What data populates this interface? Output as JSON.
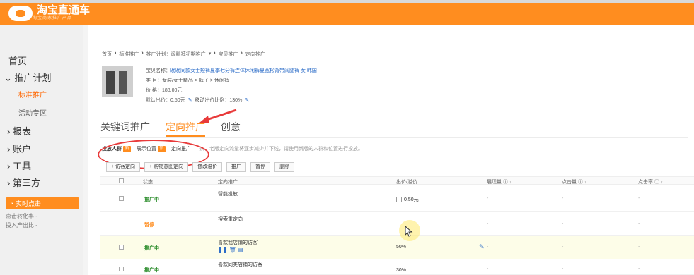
{
  "app": {
    "logo_text": "淘宝直通车",
    "logo_sub": "淘宝商家推广产品"
  },
  "sidebar": {
    "items": [
      {
        "label": "首页"
      },
      {
        "label": "推广计划",
        "prefix": "⌄"
      },
      {
        "label": "标准推广",
        "active": true
      },
      {
        "label": "活动专区"
      },
      {
        "label": "报表",
        "prefix": "›"
      },
      {
        "label": "账户",
        "prefix": "›"
      },
      {
        "label": "工具",
        "prefix": "›"
      },
      {
        "label": "第三方",
        "prefix": "›"
      }
    ],
    "realtime": {
      "button": "实时点击",
      "line1": "点击转化率  -",
      "line2": "投入产出比  -"
    }
  },
  "breadcrumb": [
    "首页",
    "标准推广",
    "推广计划：阔腿裤初期推广",
    "宝贝推广",
    "定向推广"
  ],
  "product": {
    "name_label": "宝贝名称：",
    "name": "晚晚同款女士短裤夏季七分裤连体休闲裤夏宽松背带阔腿裤 女 韩国",
    "category_label": "类    目：",
    "category": "女装/女士精品 > 裤子 > 休闲裤",
    "price_label": "价    格：",
    "price": "188.00元",
    "bid_label": "默认出价：",
    "bid": "0.50元",
    "mobile_label": "移动出价比例：",
    "mobile": "130%"
  },
  "tabs": [
    {
      "label": "关键词推广",
      "active": false
    },
    {
      "label": "定向推广",
      "active": true
    },
    {
      "label": "创意",
      "active": false
    }
  ],
  "subtabs": [
    {
      "label": "投放人群",
      "badge": "新"
    },
    {
      "label": "展示位置",
      "badge": "新"
    },
    {
      "label": "定向推广"
    }
  ],
  "notice": "亲，老版定向流量将逐步减少并下线，请使用新版的人群和位置进行投放。",
  "toolbar": [
    "+ 访客定向",
    "+ 购物意图定向",
    "修改溢价",
    "推广",
    "暂停",
    "删除"
  ],
  "table": {
    "headers": [
      "状态",
      "定向推广",
      "出价/溢价",
      "展现量 ⓘ ↕",
      "点击量 ⓘ ↕",
      "点击率 ⓘ ↕"
    ],
    "rows": [
      {
        "status": "推广中",
        "status_color": "green",
        "name": "智能投放",
        "price": "0.50元",
        "price_icon": true,
        "impr": "-",
        "clicks": "-",
        "ctr": "-"
      },
      {
        "status": "暂停",
        "status_color": "orange",
        "name": "搜索重定向",
        "price": "",
        "impr": "-",
        "clicks": "-",
        "ctr": "-"
      },
      {
        "status": "推广中",
        "status_color": "green",
        "name": "喜欢我店铺的访客",
        "price": "50%",
        "impr": "-",
        "clicks": "-",
        "ctr": "-",
        "highlight": true,
        "icons": true
      },
      {
        "status": "推广中",
        "status_color": "green",
        "name": "喜欢同类店铺的访客",
        "price": "30%",
        "impr": "-",
        "clicks": "-",
        "ctr": "-"
      }
    ]
  },
  "colors": {
    "brand": "#ff8d1f",
    "annotation": "#e83a3a",
    "link": "#2b6cc8"
  }
}
